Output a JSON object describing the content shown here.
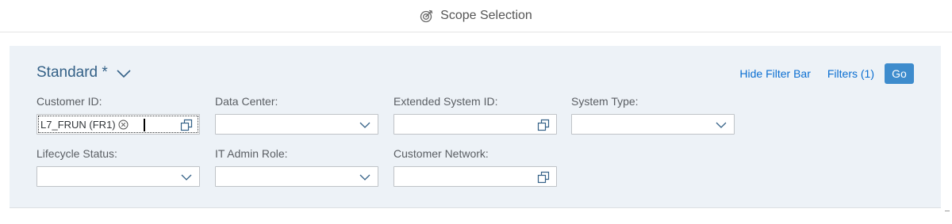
{
  "header": {
    "title": "Scope Selection",
    "icon": "target-icon"
  },
  "variant": {
    "label": "Standard *"
  },
  "toolbar": {
    "hide_filter_bar": "Hide Filter Bar",
    "filters": "Filters (1)",
    "go": "Go"
  },
  "fields": {
    "customer_id": {
      "label": "Customer ID:",
      "token": "L7_FRUN (FR1)",
      "type": "value-help"
    },
    "data_center": {
      "label": "Data Center:",
      "value": "",
      "type": "dropdown"
    },
    "extended_system_id": {
      "label": "Extended System ID:",
      "value": "",
      "type": "value-help"
    },
    "system_type": {
      "label": "System Type:",
      "value": "",
      "type": "dropdown"
    },
    "lifecycle_status": {
      "label": "Lifecycle Status:",
      "value": "",
      "type": "dropdown"
    },
    "it_admin_role": {
      "label": "IT Admin Role:",
      "value": "",
      "type": "dropdown"
    },
    "customer_network": {
      "label": "Customer Network:",
      "value": "",
      "type": "value-help"
    }
  },
  "colors": {
    "link": "#0a6ed1",
    "variant": "#346187",
    "go_button": "#3e8ccd",
    "filterbar_bg": "#edf2f7"
  }
}
